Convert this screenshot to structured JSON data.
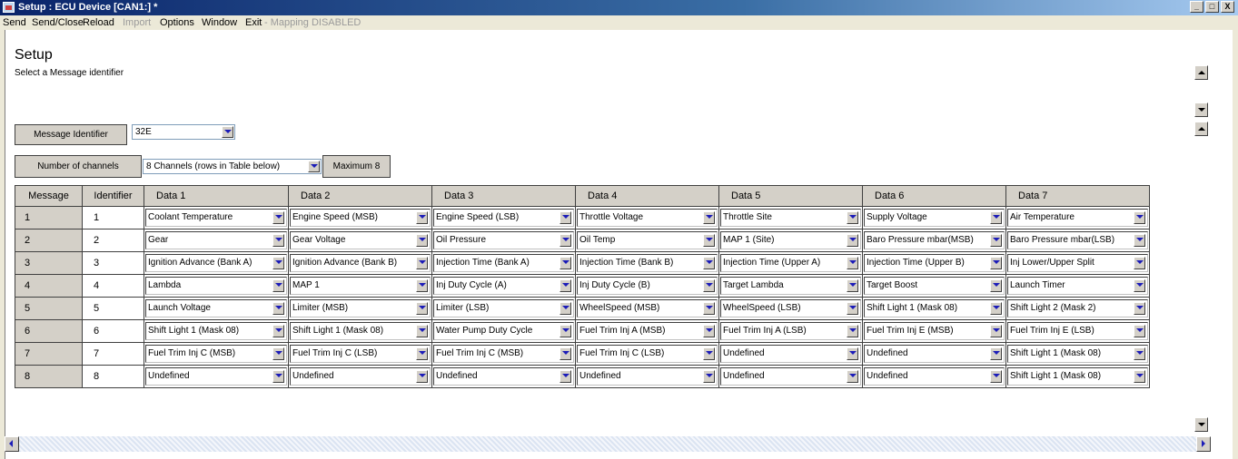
{
  "window": {
    "title": "Setup : ECU Device [CAN1:] *",
    "minimize": "_",
    "maximize": "□",
    "close": "X"
  },
  "menu": {
    "send": "Send",
    "send_close": "Send/Close",
    "reload": "Reload",
    "import": "Import",
    "options": "Options",
    "window": "Window",
    "exit": "Exit",
    "mapping": "- Mapping DISABLED"
  },
  "page": {
    "heading": "Setup",
    "subtitle": "Select a Message identifier"
  },
  "message_identifier": {
    "label": "Message Identifier",
    "value": "32E"
  },
  "channels": {
    "label": "Number of channels",
    "value": "8 Channels (rows in Table below)",
    "maximum": "Maximum 8"
  },
  "table": {
    "headers": [
      "Message",
      "Identifier",
      "Data 1",
      "Data 2",
      "Data 3",
      "Data 4",
      "Data 5",
      "Data 6",
      "Data 7"
    ],
    "rows": [
      {
        "message": "1",
        "identifier": "1",
        "data": [
          "Coolant Temperature",
          "Engine Speed (MSB)",
          "Engine Speed (LSB)",
          "Throttle Voltage",
          "Throttle Site",
          "Supply Voltage",
          "Air Temperature"
        ]
      },
      {
        "message": "2",
        "identifier": "2",
        "data": [
          "Gear",
          "Gear Voltage",
          "Oil Pressure",
          "Oil Temp",
          "MAP 1 (Site)",
          "Baro Pressure mbar(MSB)",
          "Baro Pressure mbar(LSB)"
        ]
      },
      {
        "message": "3",
        "identifier": "3",
        "data": [
          "Ignition Advance (Bank A)",
          "Ignition Advance (Bank B)",
          "Injection Time (Bank A)",
          "Injection Time (Bank B)",
          "Injection Time (Upper A)",
          "Injection Time (Upper B)",
          "Inj Lower/Upper Split"
        ]
      },
      {
        "message": "4",
        "identifier": "4",
        "data": [
          "Lambda",
          "MAP 1",
          "Inj Duty Cycle (A)",
          "Inj Duty Cycle (B)",
          "Target Lambda",
          "Target Boost",
          "Launch Timer"
        ]
      },
      {
        "message": "5",
        "identifier": "5",
        "data": [
          "Launch Voltage",
          "Limiter (MSB)",
          "Limiter (LSB)",
          "WheelSpeed (MSB)",
          "WheelSpeed (LSB)",
          "Shift Light 1 (Mask 08)",
          "Shift Light 2 (Mask 2)"
        ]
      },
      {
        "message": "6",
        "identifier": "6",
        "data": [
          "Shift Light 1 (Mask 08)",
          "Shift Light 1 (Mask 08)",
          "Water Pump Duty Cycle",
          "Fuel Trim Inj A (MSB)",
          "Fuel Trim Inj A (LSB)",
          "Fuel Trim Inj E (MSB)",
          "Fuel Trim Inj E (LSB)"
        ]
      },
      {
        "message": "7",
        "identifier": "7",
        "data": [
          "Fuel Trim Inj C (MSB)",
          "Fuel Trim Inj C (LSB)",
          "Fuel Trim Inj C (MSB)",
          "Fuel Trim Inj C (LSB)",
          "Undefined",
          "Undefined",
          "Shift Light 1 (Mask 08)"
        ]
      },
      {
        "message": "8",
        "identifier": "8",
        "data": [
          "Undefined",
          "Undefined",
          "Undefined",
          "Undefined",
          "Undefined",
          "Undefined",
          "Shift Light 1 (Mask 08)"
        ]
      }
    ]
  }
}
